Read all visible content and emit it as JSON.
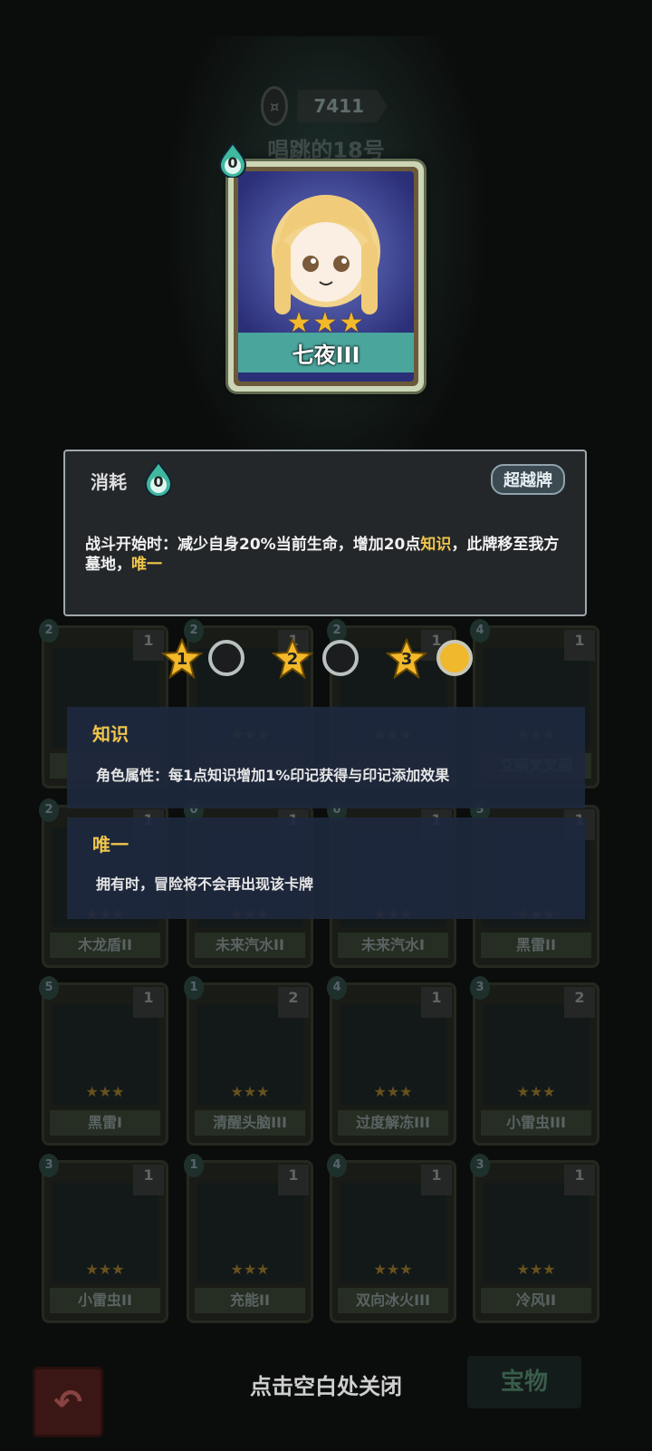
{
  "header": {
    "currency_amount": "7411",
    "character_name": "唱跳的18号"
  },
  "main_card": {
    "name": "七夜III",
    "cost": "0",
    "stars": "★★★"
  },
  "info_panel": {
    "cost_label": "消耗",
    "cost_value": "0",
    "transcend_label": "超越牌",
    "desc_part1": "战斗开始时：减少自身20%当前生命，增加20点",
    "desc_kw1": "知识",
    "desc_part2": "，此牌移至我方墓地，",
    "desc_kw2": "唯一"
  },
  "levels": {
    "items": [
      "1",
      "2",
      "3"
    ],
    "selected": 3
  },
  "keywords": [
    {
      "title": "知识",
      "text": "角色属性：每1点知识增加1%印记获得与印记添加效果"
    },
    {
      "title": "唯一",
      "text": "拥有时，冒险将不会再出现该卡牌"
    }
  ],
  "grid_cards": [
    {
      "name": "",
      "cost": "2",
      "level": "1"
    },
    {
      "name": "",
      "cost": "2",
      "level": "1"
    },
    {
      "name": "",
      "cost": "2",
      "level": "1"
    },
    {
      "name": "艾丽叉叉丽",
      "cost": "4",
      "level": "1"
    },
    {
      "name": "木龙盾II",
      "cost": "2",
      "level": "1"
    },
    {
      "name": "未来汽水II",
      "cost": "0",
      "level": "1"
    },
    {
      "name": "未来汽水I",
      "cost": "0",
      "level": "1"
    },
    {
      "name": "黑雷II",
      "cost": "5",
      "level": "1"
    },
    {
      "name": "黑雷I",
      "cost": "5",
      "level": "1"
    },
    {
      "name": "清醒头脑III",
      "cost": "1",
      "level": "2"
    },
    {
      "name": "过度解冻III",
      "cost": "4",
      "level": "1"
    },
    {
      "name": "小雷虫III",
      "cost": "3",
      "level": "2"
    },
    {
      "name": "小雷虫II",
      "cost": "3",
      "level": "1"
    },
    {
      "name": "充能II",
      "cost": "1",
      "level": "1"
    },
    {
      "name": "双向冰火III",
      "cost": "4",
      "level": "1"
    },
    {
      "name": "冷风II",
      "cost": "3",
      "level": "1"
    }
  ],
  "bottom": {
    "close_hint": "点击空白处关闭",
    "treasure_tab": "宝物",
    "back_icon": "back-arrow-icon"
  },
  "colors": {
    "highlight": "#f0c64b",
    "banner": "#4aa59d",
    "panel_bg": "#23272a"
  }
}
